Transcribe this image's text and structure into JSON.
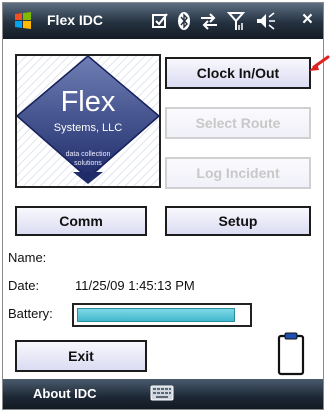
{
  "statusbar": {
    "title": "Flex IDC",
    "close_label": "×",
    "icons": [
      "windows-start-icon",
      "checkbox-icon",
      "bluetooth-icon",
      "sync-arrows-icon",
      "signal-icon",
      "volume-icon"
    ]
  },
  "logo": {
    "brand": "Flex",
    "company": "Systems, LLC",
    "tagline_1": "data collection",
    "tagline_2": "solutions"
  },
  "buttons": {
    "clock_in_out": "Clock In/Out",
    "select_route": "Select Route",
    "log_incident": "Log Incident",
    "comm": "Comm",
    "setup": "Setup",
    "exit": "Exit"
  },
  "info": {
    "name_label": "Name:",
    "name_value": "",
    "date_label": "Date:",
    "date_value": "11/25/09 1:45:13 PM",
    "battery_label": "Battery:",
    "battery_level": 0.93
  },
  "bottombar": {
    "softkey_left": "About IDC",
    "input_icon": "keyboard-icon"
  },
  "colors": {
    "button_fill": "#dcdcf3",
    "battery_fill": "#43b8cc",
    "logo_blue": "#2e3d7e",
    "annotation_arrow": "#e0231f"
  }
}
